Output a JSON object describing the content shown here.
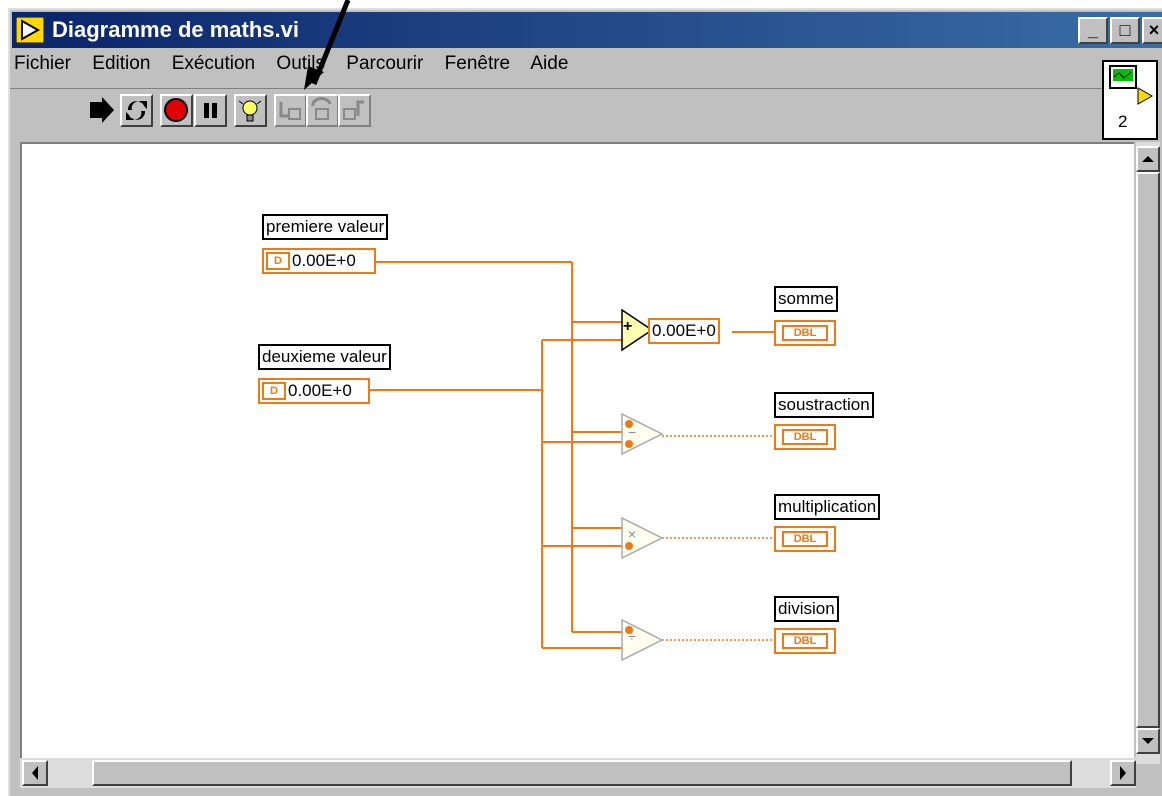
{
  "window": {
    "title": "Diagramme de maths.vi",
    "title_buttons": [
      "_",
      "□",
      "×"
    ]
  },
  "menu": [
    "Fichier",
    "Edition",
    "Exécution",
    "Outils",
    "Parcourir",
    "Fenêtre",
    "Aide"
  ],
  "toolbar": [
    "run-icon",
    "run-continuously-icon",
    "abort-icon",
    "pause-icon",
    "highlight-execution-icon",
    "step-into-icon",
    "step-over-icon",
    "step-out-icon"
  ],
  "vi_icon": {
    "number": "2"
  },
  "diagram": {
    "premiere": {
      "label": "premiere valeur",
      "type_tag": "D",
      "value": "0.00E+0"
    },
    "deuxieme": {
      "label": "deuxieme valeur",
      "type_tag": "D",
      "value": "0.00E+0"
    },
    "probe_value": "0.00E+0",
    "outputs": [
      {
        "label": "somme",
        "type": "DBL",
        "op": "+"
      },
      {
        "label": "soustraction",
        "type": "DBL",
        "op": "−"
      },
      {
        "label": "multiplication",
        "type": "DBL",
        "op": "×"
      },
      {
        "label": "division",
        "type": "DBL",
        "op": "÷"
      }
    ]
  },
  "colors": {
    "wire": "#ec7a16",
    "title_bar": "#0a246a",
    "window": "#c0c0c0"
  }
}
